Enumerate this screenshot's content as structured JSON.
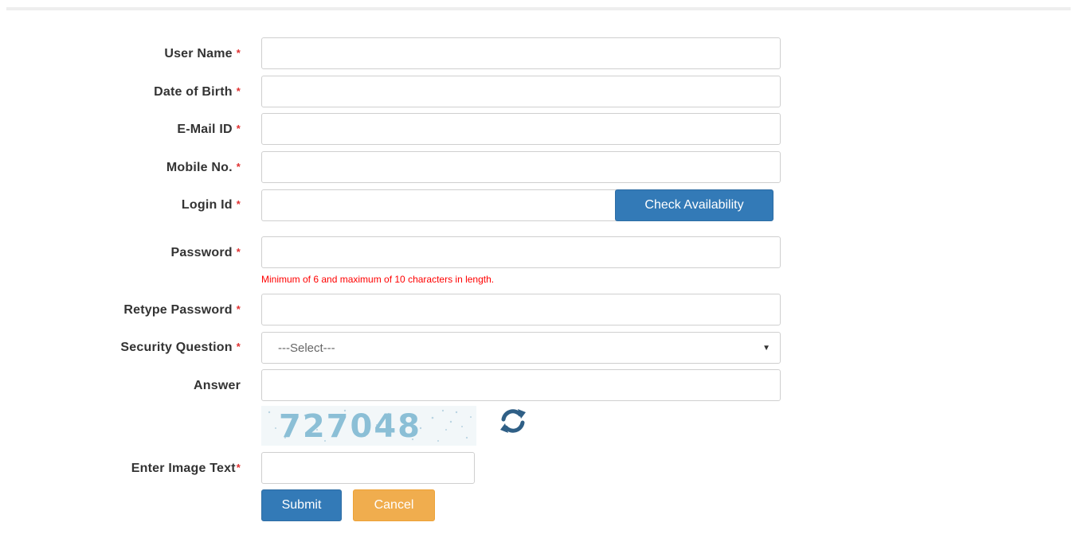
{
  "form": {
    "username_label": "User Name",
    "dob_label": "Date of Birth",
    "email_label": "E-Mail ID",
    "mobile_label": "Mobile No.",
    "login_label": "Login Id",
    "password_label": "Password",
    "retype_label": "Retype Password",
    "security_label": "Security Question",
    "answer_label": "Answer",
    "image_text_label": "Enter Image Text",
    "required_mark": "*",
    "password_hint": "Minimum of 6 and maximum of 10 characters in length.",
    "security_selected": "---Select---",
    "captcha_text": "727048",
    "check_availability_label": "Check Availability",
    "submit_label": "Submit",
    "cancel_label": "Cancel"
  },
  "values": {
    "username": "",
    "dob": "",
    "email": "",
    "mobile": "",
    "login": "",
    "password": "",
    "retype": "",
    "answer": "",
    "image_text": ""
  },
  "icons": {
    "refresh": "refresh-icon",
    "select_caret": "caret-down-icon"
  },
  "colors": {
    "primary": "#337ab7",
    "warning": "#f0ad4e",
    "required": "#e03131",
    "hint": "#ff0000",
    "captcha_text": "#8bbfd6"
  }
}
